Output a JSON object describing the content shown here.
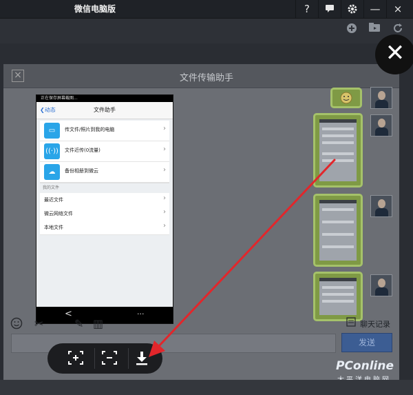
{
  "window": {
    "title": "微信电脑版",
    "controls": [
      "?",
      "chat-bubble-icon",
      "gear-icon",
      "—",
      "×"
    ]
  },
  "chat": {
    "title": "文件传输助手",
    "history_label": "聊天记录",
    "send_label": "发送"
  },
  "phone": {
    "status_text": "正在保存屏幕截图...",
    "nav_back": "动态",
    "nav_title": "文件助手",
    "menu_items": [
      {
        "icon": "monitor-icon",
        "label": "传文件/照片到我的电脑"
      },
      {
        "icon": "wifi-transfer-icon",
        "label": "文件近传(0流量)"
      },
      {
        "icon": "cloud-icon",
        "label": "备份相册到微云"
      }
    ],
    "section_label": "我的文件",
    "list_items": [
      "最近文件",
      "微云网络文件",
      "本地文件"
    ],
    "bottom_back": "<",
    "bottom_menu": "···"
  },
  "float_toolbar": {
    "buttons": [
      "zoom-in-icon",
      "zoom-out-icon",
      "download-icon"
    ],
    "zoom_in": "+",
    "zoom_out": "−"
  },
  "watermark": {
    "logo": "PConline",
    "sub": "太平洋电脑网"
  },
  "colors": {
    "accent_green": "#a5c26a",
    "annotation_arrow": "#e2262b",
    "send_button": "#3c5d93"
  }
}
